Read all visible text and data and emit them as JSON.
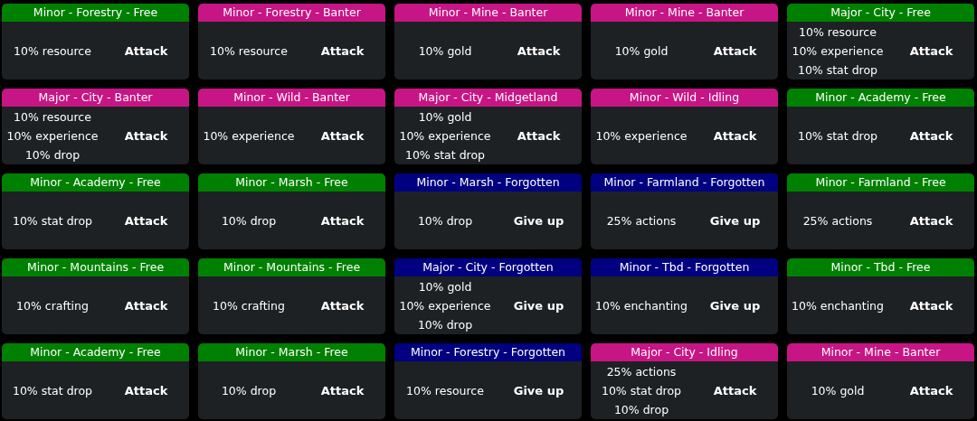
{
  "cards": [
    {
      "header": "Minor - Forestry - Free",
      "color": "#008000",
      "rewards": [
        "10% resource"
      ],
      "action": "Attack"
    },
    {
      "header": "Minor - Forestry - Banter",
      "color": "#c71585",
      "rewards": [
        "10% resource"
      ],
      "action": "Attack"
    },
    {
      "header": "Minor - Mine - Banter",
      "color": "#c71585",
      "rewards": [
        "10% gold"
      ],
      "action": "Attack"
    },
    {
      "header": "Minor - Mine - Banter",
      "color": "#c71585",
      "rewards": [
        "10% gold"
      ],
      "action": "Attack"
    },
    {
      "header": "Major - City - Free",
      "color": "#008000",
      "rewards": [
        "10% resource",
        "10% experience",
        "10% stat drop"
      ],
      "action": "Attack"
    },
    {
      "header": "Major - City - Banter",
      "color": "#c71585",
      "rewards": [
        "10% resource",
        "10% experience",
        "10% drop"
      ],
      "action": "Attack"
    },
    {
      "header": "Minor - Wild - Banter",
      "color": "#c71585",
      "rewards": [
        "10% experience"
      ],
      "action": "Attack"
    },
    {
      "header": "Major - City - Midgetland",
      "color": "#c71585",
      "rewards": [
        "10% gold",
        "10% experience",
        "10% stat drop"
      ],
      "action": "Attack"
    },
    {
      "header": "Minor - Wild - Idling",
      "color": "#c71585",
      "rewards": [
        "10% experience"
      ],
      "action": "Attack"
    },
    {
      "header": "Minor - Academy - Free",
      "color": "#008000",
      "rewards": [
        "10% stat drop"
      ],
      "action": "Attack"
    },
    {
      "header": "Minor - Academy - Free",
      "color": "#008000",
      "rewards": [
        "10% stat drop"
      ],
      "action": "Attack"
    },
    {
      "header": "Minor - Marsh - Free",
      "color": "#008000",
      "rewards": [
        "10% drop"
      ],
      "action": "Attack"
    },
    {
      "header": "Minor - Marsh - Forgotten",
      "color": "#000080",
      "rewards": [
        "10% drop"
      ],
      "action": "Give up"
    },
    {
      "header": "Minor - Farmland - Forgotten",
      "color": "#000080",
      "rewards": [
        "25% actions"
      ],
      "action": "Give up"
    },
    {
      "header": "Minor - Farmland - Free",
      "color": "#008000",
      "rewards": [
        "25% actions"
      ],
      "action": "Attack"
    },
    {
      "header": "Minor - Mountains - Free",
      "color": "#008000",
      "rewards": [
        "10% crafting"
      ],
      "action": "Attack"
    },
    {
      "header": "Minor - Mountains - Free",
      "color": "#008000",
      "rewards": [
        "10% crafting"
      ],
      "action": "Attack"
    },
    {
      "header": "Major - City - Forgotten",
      "color": "#000080",
      "rewards": [
        "10% gold",
        "10% experience",
        "10% drop"
      ],
      "action": "Give up"
    },
    {
      "header": "Minor - Tbd - Forgotten",
      "color": "#000080",
      "rewards": [
        "10% enchanting"
      ],
      "action": "Give up"
    },
    {
      "header": "Minor - Tbd - Free",
      "color": "#008000",
      "rewards": [
        "10% enchanting"
      ],
      "action": "Attack"
    },
    {
      "header": "Minor - Academy - Free",
      "color": "#008000",
      "rewards": [
        "10% stat drop"
      ],
      "action": "Attack"
    },
    {
      "header": "Minor - Marsh - Free",
      "color": "#008000",
      "rewards": [
        "10% drop"
      ],
      "action": "Attack"
    },
    {
      "header": "Minor - Forestry - Forgotten",
      "color": "#000080",
      "rewards": [
        "10% resource"
      ],
      "action": "Give up"
    },
    {
      "header": "Major - City - Idling",
      "color": "#c71585",
      "rewards": [
        "25% actions",
        "10% stat drop",
        "10% drop"
      ],
      "action": "Attack"
    },
    {
      "header": "Minor - Mine - Banter",
      "color": "#c71585",
      "rewards": [
        "10% gold"
      ],
      "action": "Attack"
    }
  ]
}
